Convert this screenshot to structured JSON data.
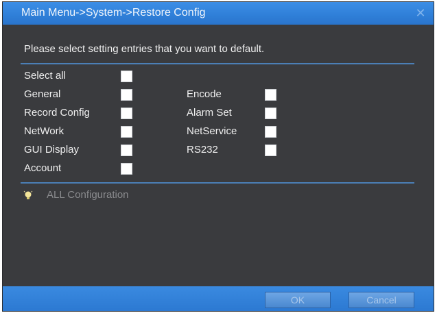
{
  "window": {
    "title": "Main Menu->System->Restore Config"
  },
  "prompt": "Please select setting entries that you want to default.",
  "entries": {
    "select_all": "Select all",
    "general": "General",
    "record_config": "Record Config",
    "network": "NetWork",
    "gui_display": "GUI Display",
    "account": "Account",
    "encode": "Encode",
    "alarm_set": "Alarm Set",
    "netservice": "NetService",
    "rs232": "RS232"
  },
  "all_configuration": "ALL Configuration",
  "buttons": {
    "ok": "OK",
    "cancel": "Cancel"
  },
  "colors": {
    "titlebar": "#2f7fd8",
    "panel": "#3a3b3e",
    "divider": "#4b7fb6",
    "checkbox": "#ffffff",
    "disabled_text": "#8a8b8e"
  },
  "icons": {
    "close": "close-icon",
    "bulb": "lightbulb-icon"
  }
}
